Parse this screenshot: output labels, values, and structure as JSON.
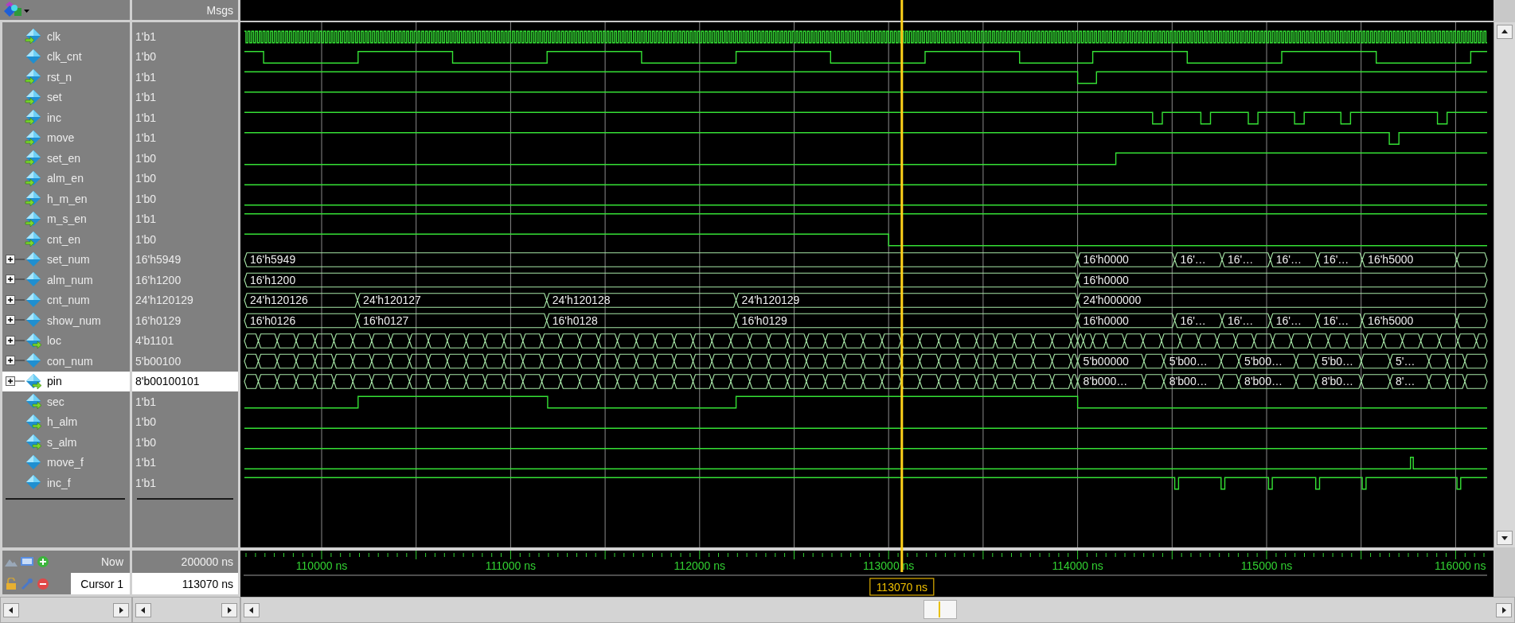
{
  "header": {
    "value_column": "Msgs"
  },
  "signals": [
    {
      "name": "clk",
      "value": "1'b1",
      "kind": "bit",
      "input": true,
      "output": false,
      "selected": false
    },
    {
      "name": "clk_cnt",
      "value": "1'b0",
      "kind": "bit",
      "input": false,
      "output": false,
      "selected": false
    },
    {
      "name": "rst_n",
      "value": "1'b1",
      "kind": "bit",
      "input": true,
      "output": false,
      "selected": false
    },
    {
      "name": "set",
      "value": "1'b1",
      "kind": "bit",
      "input": true,
      "output": false,
      "selected": false
    },
    {
      "name": "inc",
      "value": "1'b1",
      "kind": "bit",
      "input": true,
      "output": false,
      "selected": false
    },
    {
      "name": "move",
      "value": "1'b1",
      "kind": "bit",
      "input": true,
      "output": false,
      "selected": false
    },
    {
      "name": "set_en",
      "value": "1'b0",
      "kind": "bit",
      "input": true,
      "output": false,
      "selected": false
    },
    {
      "name": "alm_en",
      "value": "1'b0",
      "kind": "bit",
      "input": true,
      "output": false,
      "selected": false
    },
    {
      "name": "h_m_en",
      "value": "1'b0",
      "kind": "bit",
      "input": true,
      "output": false,
      "selected": false
    },
    {
      "name": "m_s_en",
      "value": "1'b1",
      "kind": "bit",
      "input": true,
      "output": false,
      "selected": false
    },
    {
      "name": "cnt_en",
      "value": "1'b0",
      "kind": "bit",
      "input": true,
      "output": false,
      "selected": false
    },
    {
      "name": "set_num",
      "value": "16'h5949",
      "kind": "bus",
      "input": false,
      "output": false,
      "selected": false,
      "segments": [
        "16'h5949",
        "16'h0000",
        "16'…",
        "16'…",
        "16'…",
        "16'…",
        "16'h5000"
      ]
    },
    {
      "name": "alm_num",
      "value": "16'h1200",
      "kind": "bus",
      "input": false,
      "output": false,
      "selected": false,
      "segments": [
        "16'h1200",
        "16'h0000"
      ]
    },
    {
      "name": "cnt_num",
      "value": "24'h120129",
      "kind": "bus",
      "input": false,
      "output": false,
      "selected": false,
      "segments": [
        "24'h120126",
        "24'h120127",
        "24'h120128",
        "24'h120129",
        "24'h000000"
      ]
    },
    {
      "name": "show_num",
      "value": "16'h0129",
      "kind": "bus",
      "input": false,
      "output": false,
      "selected": false,
      "segments": [
        "16'h0126",
        "16'h0127",
        "16'h0128",
        "16'h0129",
        "16'h0000",
        "16'…",
        "16'…",
        "16'…",
        "16'…",
        "16'h5000"
      ]
    },
    {
      "name": "loc",
      "value": "4'b1101",
      "kind": "bus",
      "input": false,
      "output": true,
      "selected": false
    },
    {
      "name": "con_num",
      "value": "5'b00100",
      "kind": "bus",
      "input": false,
      "output": false,
      "selected": false,
      "segments": [
        "5'b00000",
        "5'b00…",
        "5'b00…",
        "5'b0…",
        "5'…"
      ]
    },
    {
      "name": "pin",
      "value": "8'b00100101",
      "kind": "bus",
      "input": false,
      "output": true,
      "selected": true,
      "segments": [
        "8'b000…",
        "8'b00…",
        "8'b00…",
        "8'b0…",
        "8'…"
      ]
    },
    {
      "name": "sec",
      "value": "1'b1",
      "kind": "bit",
      "input": false,
      "output": true,
      "selected": false
    },
    {
      "name": "h_alm",
      "value": "1'b0",
      "kind": "bit",
      "input": false,
      "output": true,
      "selected": false
    },
    {
      "name": "s_alm",
      "value": "1'b0",
      "kind": "bit",
      "input": false,
      "output": true,
      "selected": false
    },
    {
      "name": "move_f",
      "value": "1'b1",
      "kind": "bit",
      "input": false,
      "output": false,
      "selected": false
    },
    {
      "name": "inc_f",
      "value": "1'b1",
      "kind": "bit",
      "input": false,
      "output": false,
      "selected": false
    }
  ],
  "time_axis": {
    "ticks": [
      "110000 ns",
      "111000 ns",
      "112000 ns",
      "113000 ns",
      "114000 ns",
      "115000 ns",
      "116000 ns"
    ]
  },
  "now": {
    "label": "Now",
    "value": "200000 ns"
  },
  "cursor": {
    "label": "Cursor 1",
    "value": "113070 ns",
    "marker": "113070 ns"
  }
}
